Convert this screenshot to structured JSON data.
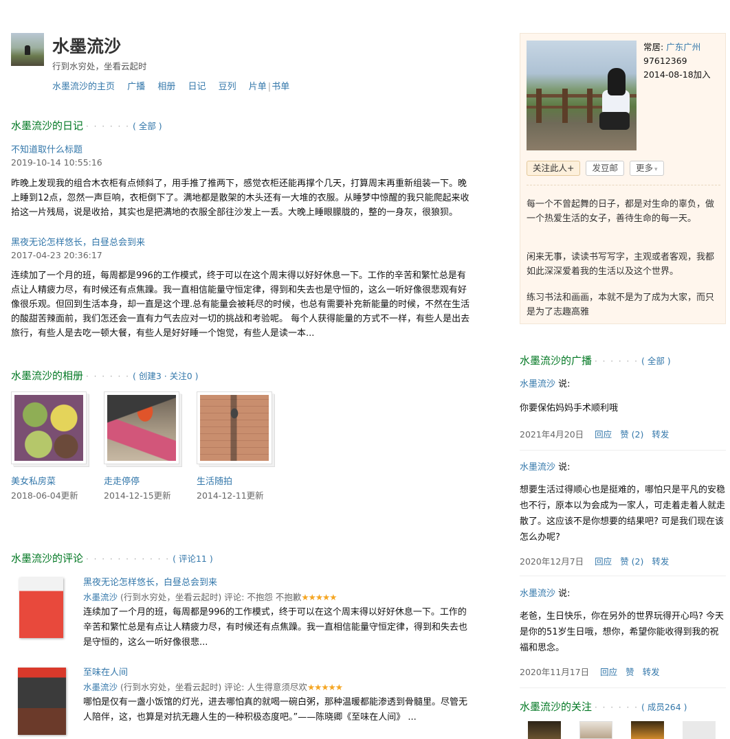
{
  "header": {
    "name": "水墨流沙",
    "tagline": "行到水穷处，坐看云起时",
    "nav": [
      "水墨流沙的主页",
      "广播",
      "相册",
      "日记",
      "豆列",
      "片单",
      "书单"
    ]
  },
  "diary": {
    "title": "水墨流沙的日记",
    "all_link": "( 全部 )",
    "entries": [
      {
        "title": "不知道取什么标题",
        "date": "2019-10-14 10:55:16",
        "body": "昨晚上发现我的组合木衣柜有点倾斜了，用手推了推两下，感觉衣柜还能再撑个几天，打算周末再重新组装一下。晚上睡到12点，忽然一声巨响，衣柜倒下了。满地都是散架的木头还有一大堆的衣服。从睡梦中惊醒的我只能爬起来收拾这一片残局，说是收拾，其实也是把满地的衣服全部往沙发上一丢。大晚上睡眼朦胧的，整的一身灰，很狼狈。"
      },
      {
        "title": "黑夜无论怎样悠长，白昼总会到来",
        "date": "2017-04-23 20:36:17",
        "body": "连续加了一个月的班，每周都是996的工作模式，终于可以在这个周末得以好好休息一下。工作的辛苦和繁忙总是有点让人精疲力尽，有时候还有点焦躁。我一直相信能量守恒定律，得到和失去也是守恒的，这么一听好像很悲观有好像很乐观。但回到生活本身，却一直是这个理.总有能量会被耗尽的时候，也总有需要补充新能量的时候，不然在生活的酸甜苦辣面前，我们怎还会一直有力气去应对一切的挑战和考验呢。 每个人获得能量的方式不一样，有些人是出去旅行，有些人是去吃一顿大餐，有些人是好好睡一个饱觉，有些人是读一本..."
      }
    ]
  },
  "albums": {
    "title": "水墨流沙的相册",
    "stats": "( 创建3 · 关注0 )",
    "items": [
      {
        "name": "美女私房菜",
        "date": "2018-06-04更新"
      },
      {
        "name": "走走停停",
        "date": "2014-12-15更新"
      },
      {
        "name": "生活随拍",
        "date": "2014-12-11更新"
      }
    ]
  },
  "reviews": {
    "title": "水墨流沙的评论",
    "count": "( 评论11 )",
    "items": [
      {
        "title": "黑夜无论怎样悠长，白昼总会到来",
        "author": "水墨流沙",
        "author_tag": "(行到水穷处，坐看云起时)",
        "subject": "评论: 不抱怨 不抱歉",
        "stars": "★★★★★",
        "body": "连续加了一个月的班，每周都是996的工作模式，终于可以在这个周末得以好好休息一下。工作的辛苦和繁忙总是有点让人精疲力尽，有时候还有点焦躁。我一直相信能量守恒定律，得到和失去也是守恒的，这么一听好像很悲..."
      },
      {
        "title": "至味在人间",
        "author": "水墨流沙",
        "author_tag": "(行到水穷处，坐看云起时)",
        "subject": "评论: 人生得意须尽欢",
        "stars": "★★★★★",
        "body": "哪怕是仅有一盏小饭馆的灯光，进去哪怕真的就喝一碗白粥，那种温暖都能渗透到骨髓里。尽管无人陪伴，这，也算是对抗无趣人生的一种积极态度吧。”——陈晓卿《至味在人间》 ..."
      }
    ]
  },
  "profile": {
    "location_label": "常居:",
    "location": "广东广州",
    "id": "97612369",
    "joined": "2014-08-18加入",
    "follow_btn": "关注此人+",
    "mail_btn": "发豆邮",
    "more_btn": "更多",
    "intro": [
      "每一个不曾起舞的日子，都是对生命的辜负，做一个热爱生活的女子，善待生命的每一天。",
      "闲来无事，读读书写写字，主观或者客观，我都如此深深爱着我的生活以及这个世界。",
      "练习书法和画画，本就不是为了成为大家，而只是为了志趣高雅"
    ]
  },
  "broadcast": {
    "title": "水墨流沙的广播",
    "all_link": "( 全部 )",
    "items": [
      {
        "who": "水墨流沙",
        "says": " 说:",
        "text": "你要保佑妈妈手术顺利哦",
        "date": "2021年4月20日",
        "reply": "回应",
        "like": "赞 (2)",
        "share": "转发"
      },
      {
        "who": "水墨流沙",
        "says": " 说:",
        "text": "想要生活过得顺心也是挺难的，哪怕只是平凡的安稳也不行，原本以为会成为一家人，可走着走着人就走散了。这应该不是你想要的结果吧? 可是我们现在该怎么办呢?",
        "date": "2020年12月7日",
        "reply": "回应",
        "like": "赞 (2)",
        "share": "转发"
      },
      {
        "who": "水墨流沙",
        "says": " 说:",
        "text": "老爸，生日快乐，你在另外的世界玩得开心吗? 今天是你的51岁生日哦，想你，希望你能收得到我的祝福和思念。",
        "date": "2020年11月17日",
        "reply": "回应",
        "like": "赞",
        "share": "转发"
      }
    ]
  },
  "following": {
    "title": "水墨流沙的关注",
    "count": "( 成员264 )"
  }
}
